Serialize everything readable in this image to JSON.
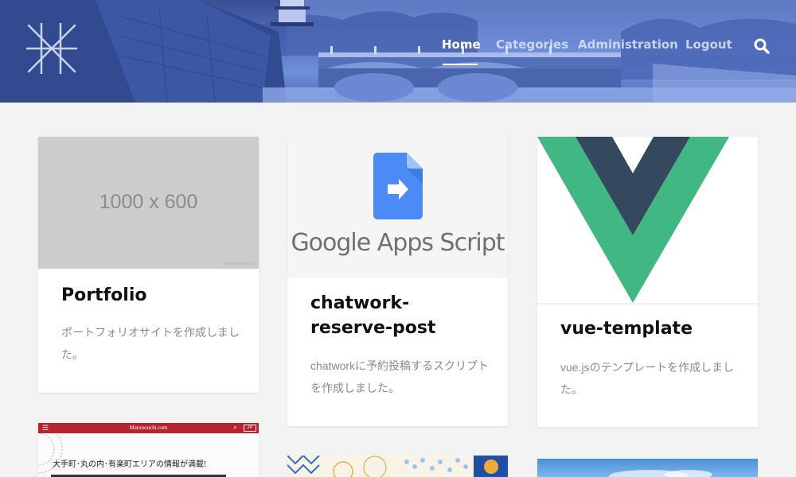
{
  "nav": {
    "items": [
      {
        "label": "Home",
        "active": true
      },
      {
        "label": "Categories",
        "active": false
      },
      {
        "label": "Administration",
        "active": false
      },
      {
        "label": "Logout",
        "active": false
      }
    ],
    "search_icon": "search-icon"
  },
  "colors": {
    "page_bg": "#f3f3f3",
    "vue_green": "#41b883",
    "vue_dark": "#34495e",
    "gas_blue": "#4c8bf5",
    "banner_red": "#b5242f"
  },
  "cards": [
    {
      "title": "Portfolio",
      "text": "ポートフォリオサイトを作成しました。",
      "thumb_text": "1000 x 600",
      "thumb_mark": "www.dummy.com"
    },
    {
      "title": "chatwork-reserve-post",
      "text": "chatworkに予約投稿するスクリプトを作成しました。",
      "thumb_text": "Google Apps Script"
    },
    {
      "title": "vue-template",
      "text": "vue.jsのテンプレートを作成しました。"
    }
  ],
  "row2": {
    "banner_title": "Marunouchi.com",
    "banner_text": "大手町･丸の内･有楽町エリアの情報が満載!",
    "banner_button": "JP"
  }
}
